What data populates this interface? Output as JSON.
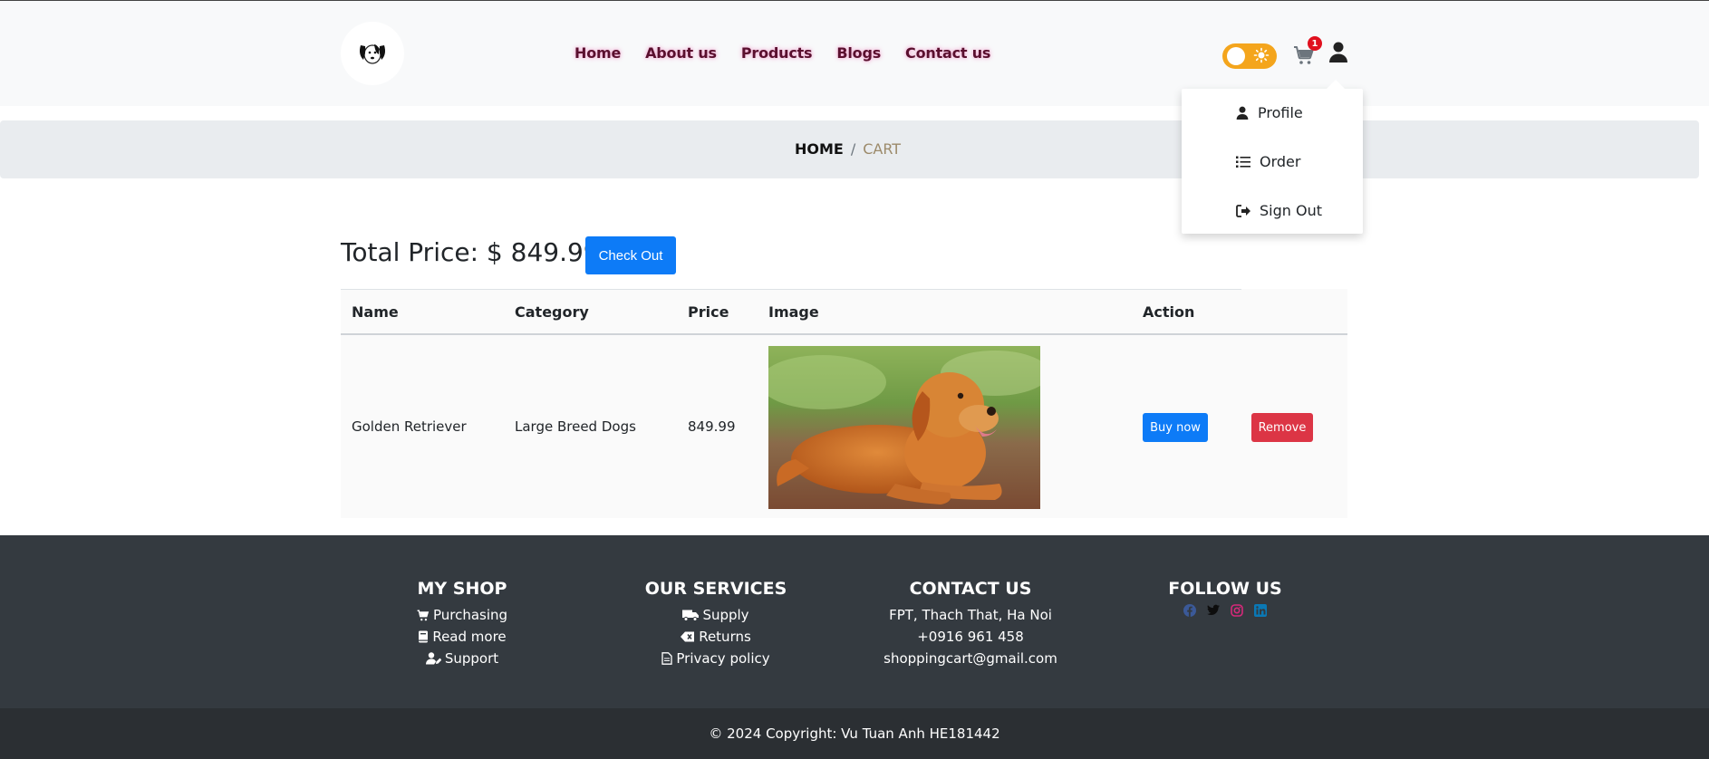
{
  "header": {
    "nav": [
      "Home",
      "About us",
      "Products",
      "Blogs",
      "Contact us"
    ],
    "cart_count": "1"
  },
  "user_menu": {
    "items": [
      "Profile",
      "Order",
      "Sign Out"
    ]
  },
  "breadcrumb": {
    "home": "HOME",
    "separator": "/",
    "current": "CART"
  },
  "cart": {
    "total_label": "Total Price: $ 849.99",
    "checkout_label": "Check Out",
    "columns": [
      "Name",
      "Category",
      "Price",
      "Image",
      "Action"
    ],
    "rows": [
      {
        "name": "Golden Retriever",
        "category": "Large Breed Dogs",
        "price": "849.99",
        "buy_label": "Buy now",
        "remove_label": "Remove"
      }
    ]
  },
  "footer": {
    "my_shop": {
      "title": "MY SHOP",
      "items": [
        "Purchasing",
        "Read more",
        "Support"
      ]
    },
    "services": {
      "title": "OUR SERVICES",
      "items": [
        "Supply",
        "Returns",
        "Privacy policy"
      ]
    },
    "contact": {
      "title": "CONTACT US",
      "items": [
        "FPT, Thach That, Ha Noi",
        "+0916 961 458",
        "shoppingcart@gmail.com"
      ]
    },
    "follow": {
      "title": "FOLLOW US",
      "icons": [
        "facebook-icon",
        "twitter-icon",
        "instagram-icon",
        "linkedin-icon"
      ]
    },
    "copyright": "© 2024 Copyright: Vu Tuan Anh HE181442"
  },
  "colors": {
    "primary": "#0d7bf7",
    "danger": "#dc3545",
    "toggle": "#f4a51c",
    "footer_bg": "#343a40"
  }
}
